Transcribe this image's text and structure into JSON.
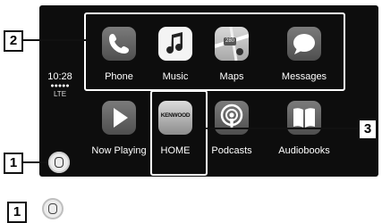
{
  "status": {
    "time": "10:28",
    "signal": "●●●●●",
    "network": "LTE"
  },
  "apps": [
    {
      "name": "Phone",
      "icon": "phone-icon"
    },
    {
      "name": "Music",
      "icon": "music-note-icon"
    },
    {
      "name": "Maps",
      "icon": "maps-icon",
      "badge": "280"
    },
    {
      "name": "Messages",
      "icon": "speech-bubble-icon"
    },
    {
      "name": "Now Playing",
      "icon": "play-icon"
    },
    {
      "name": "HOME",
      "icon": "kenwood-logo-icon",
      "logo_text": "KENWOOD"
    },
    {
      "name": "Podcasts",
      "icon": "podcasts-icon"
    },
    {
      "name": "Audiobooks",
      "icon": "book-icon"
    }
  ],
  "callouts": {
    "one": "1",
    "two": "2",
    "three": "3"
  },
  "legend": {
    "number": "1"
  },
  "colors": {
    "screen": "#0d0d0d",
    "tile": "#666666",
    "highlight": "#ffffff"
  }
}
